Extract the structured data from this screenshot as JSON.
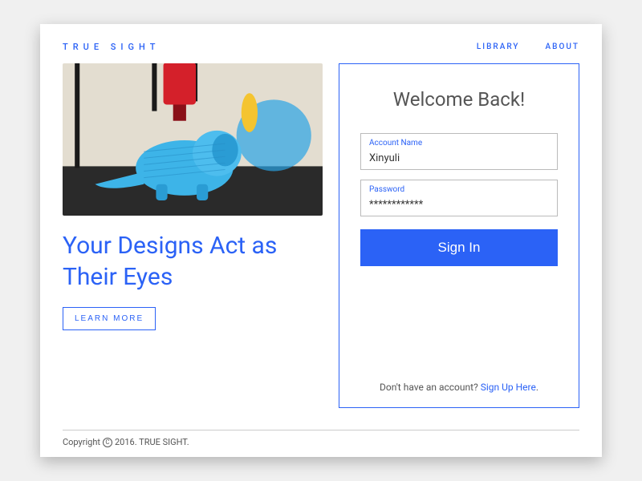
{
  "brand": "TRUE SIGHT",
  "nav": {
    "library": "LIBRARY",
    "about": "ABOUT"
  },
  "hero": {
    "headline": "Your Designs Act as Their Eyes",
    "learn_more": "LEARN MORE"
  },
  "login": {
    "welcome": "Welcome Back!",
    "account_label": "Account Name",
    "account_value": "Xinyuli",
    "password_label": "Password",
    "password_value": "************",
    "signin": "Sign In",
    "no_account": "Don't have an account? ",
    "signup": "Sign Up Here",
    "period": "."
  },
  "footer": {
    "pre": "Copyright",
    "post": "2016. TRUE SIGHT."
  }
}
